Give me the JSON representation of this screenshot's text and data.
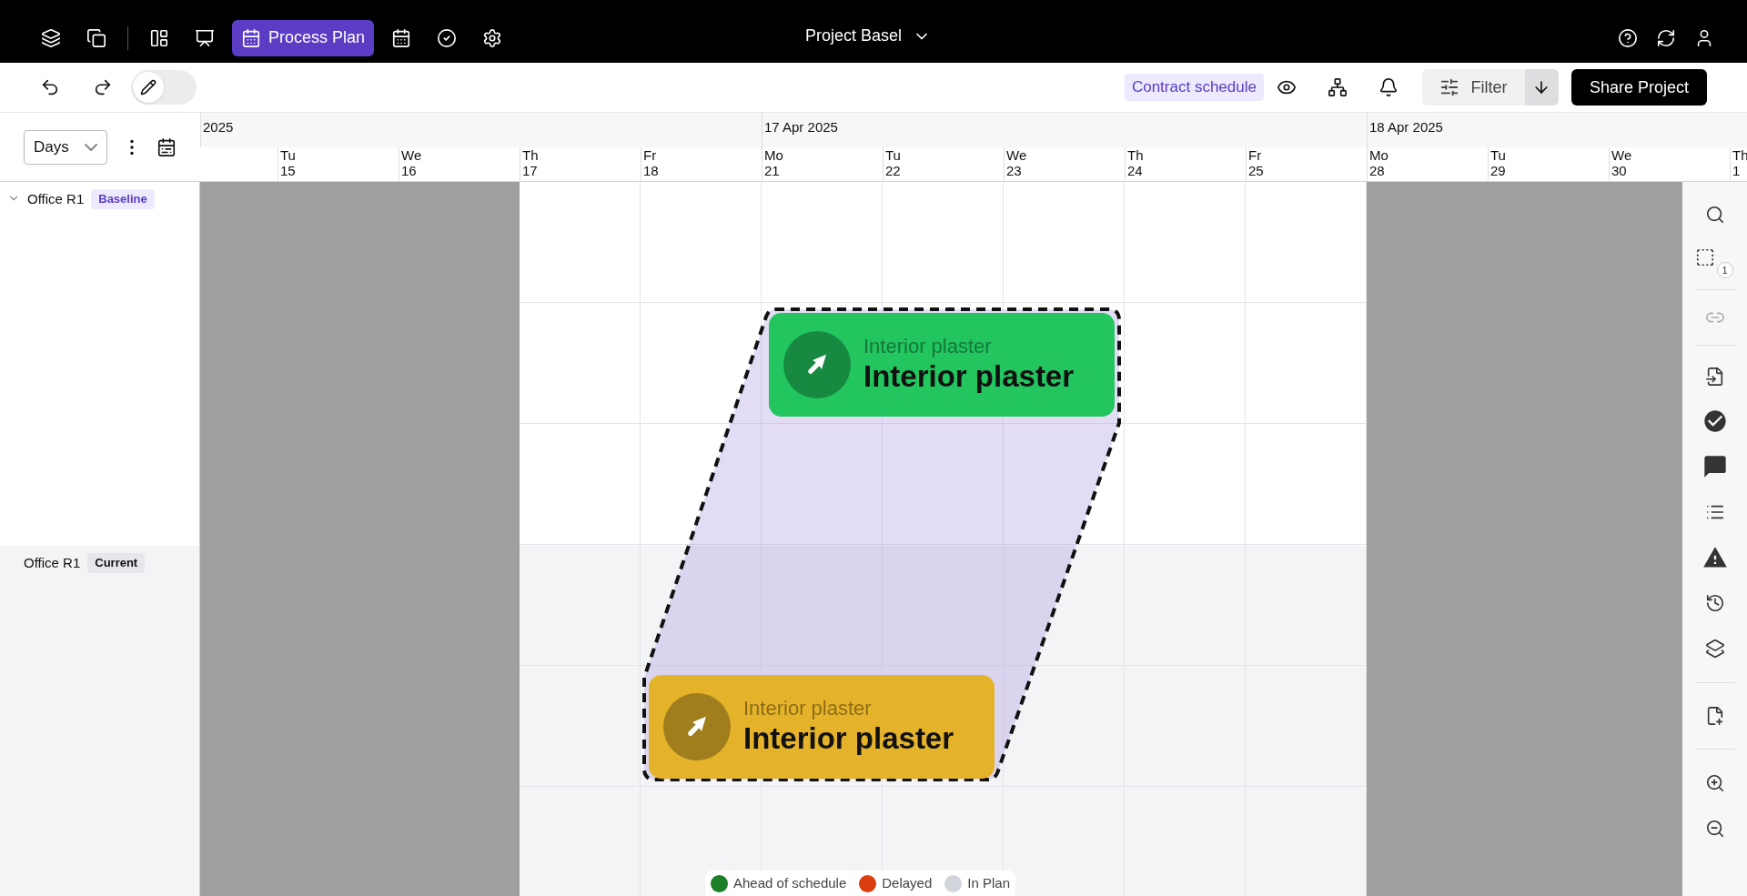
{
  "top_bar": {
    "active_view": "Process Plan",
    "project": "Project Basel"
  },
  "toolbar": {
    "edit_toggle": {
      "on": false
    },
    "schedule_tag": "Contract schedule",
    "filter": "Filter",
    "share": "Share Project"
  },
  "zoom_select": {
    "value": "Days"
  },
  "timeline": {
    "months": [
      {
        "label": "2025",
        "days": [
          {
            "weekday": "Tu",
            "date": "15",
            "shaded": true
          },
          {
            "weekday": "We",
            "date": "16",
            "shaded": true
          },
          {
            "weekday": "Th",
            "date": "17",
            "shaded": false
          },
          {
            "weekday": "Fr",
            "date": "18",
            "shaded": false
          }
        ]
      },
      {
        "label": "17 Apr 2025",
        "days": [
          {
            "weekday": "Mo",
            "date": "21",
            "shaded": false
          },
          {
            "weekday": "Tu",
            "date": "22",
            "shaded": false
          },
          {
            "weekday": "We",
            "date": "23",
            "shaded": false
          },
          {
            "weekday": "Th",
            "date": "24",
            "shaded": false
          },
          {
            "weekday": "Fr",
            "date": "25",
            "shaded": false
          }
        ]
      },
      {
        "label": "18 Apr 2025",
        "days": [
          {
            "weekday": "Mo",
            "date": "28",
            "shaded": true
          },
          {
            "weekday": "Tu",
            "date": "29",
            "shaded": true
          },
          {
            "weekday": "We",
            "date": "30",
            "shaded": true
          },
          {
            "weekday": "Th",
            "date": "1"
          }
        ]
      }
    ]
  },
  "rows": [
    {
      "kind": "baseline",
      "label": "Office R1",
      "tag": "Baseline"
    },
    {
      "kind": "current",
      "label": "Office R1",
      "tag": "Current"
    }
  ],
  "tasks": [
    {
      "category": "Interior plaster",
      "name": "Interior plaster",
      "color": "#22c55e"
    },
    {
      "category": "Interior plaster",
      "name": "Interior plaster",
      "color": "#e5b32a"
    }
  ],
  "sidebar": {
    "selection_count": "1"
  },
  "legend": [
    {
      "label": "Ahead of schedule",
      "color": "#1a7f26"
    },
    {
      "label": "Delayed",
      "color": "#dc3d0f"
    },
    {
      "label": "In Plan",
      "color": "#d1d5db"
    }
  ]
}
